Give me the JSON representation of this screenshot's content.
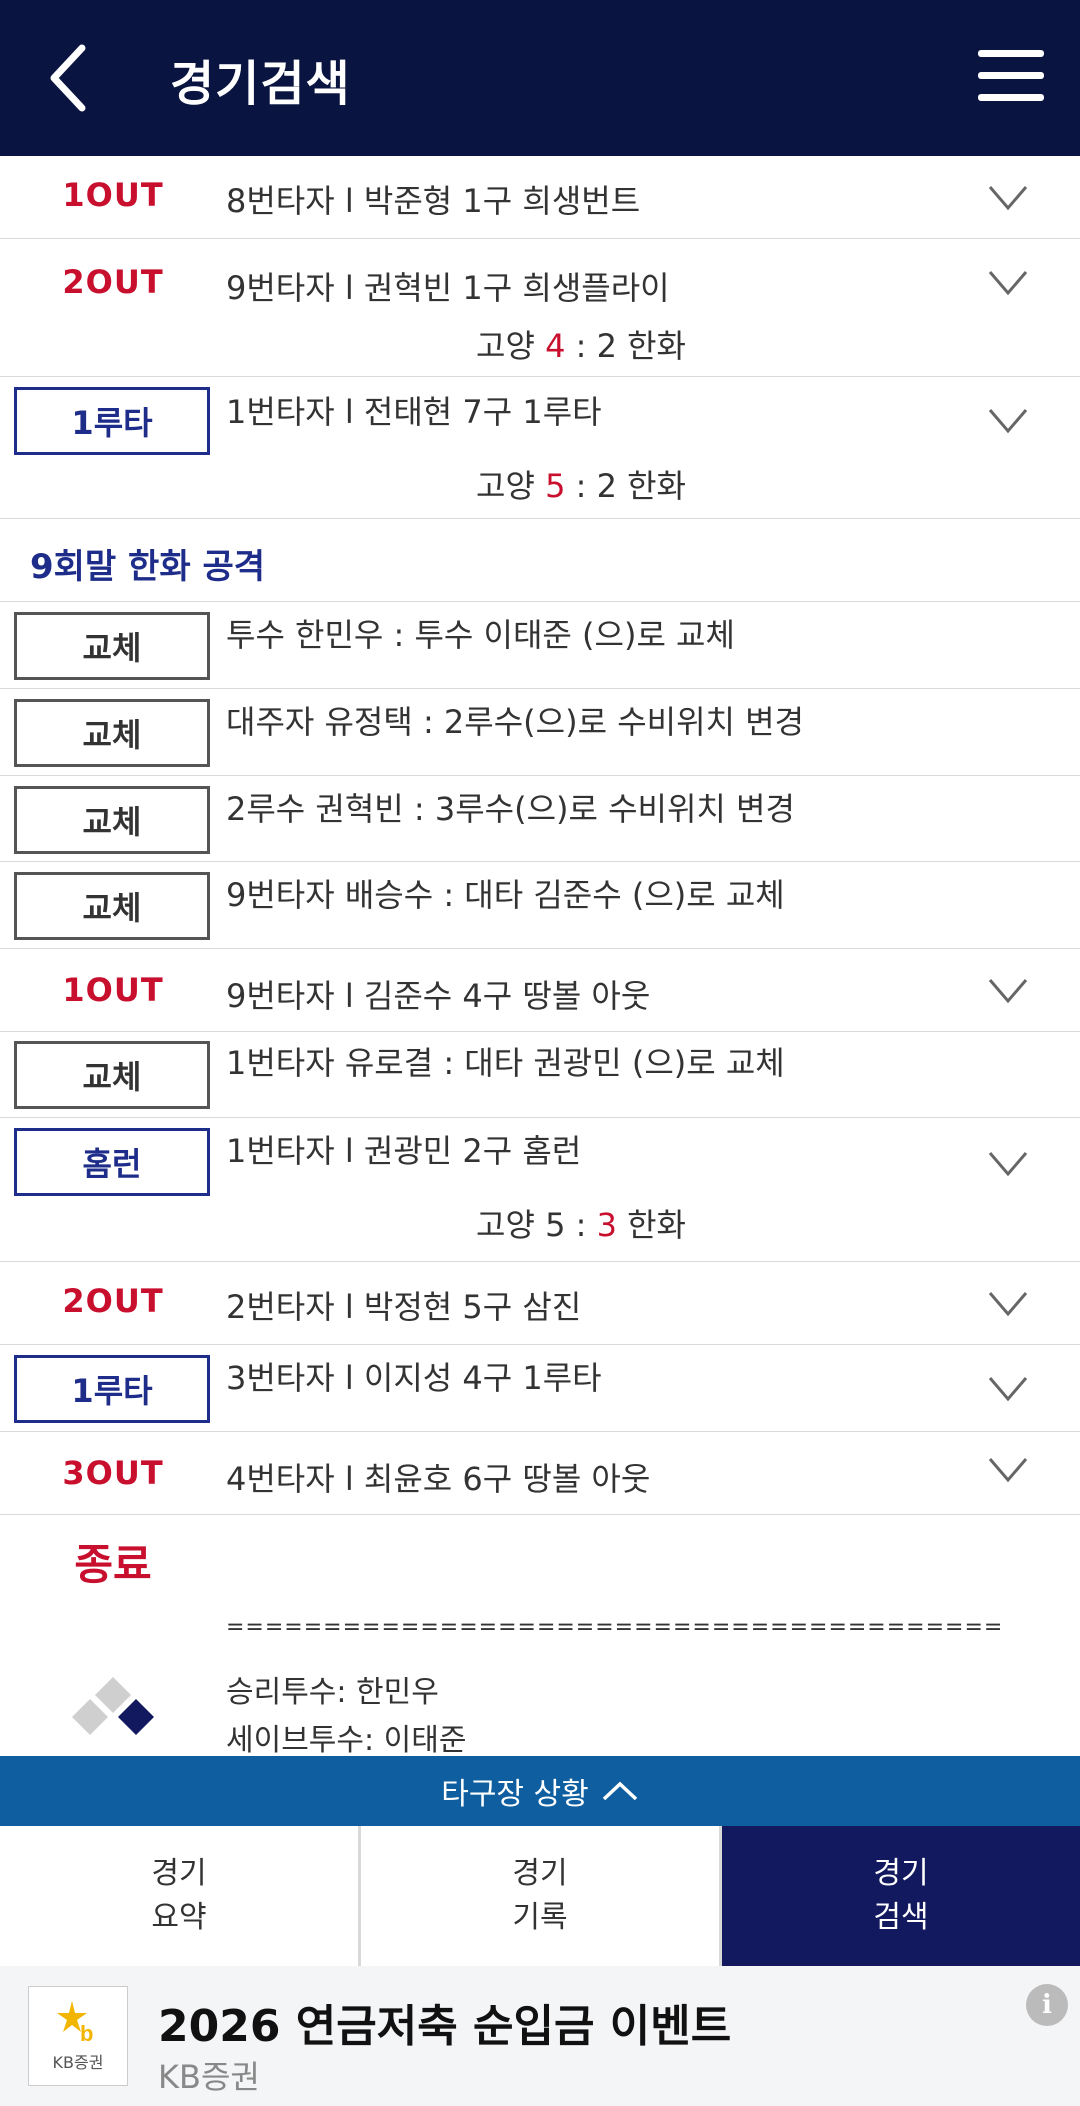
{
  "header": {
    "title": "경기검색"
  },
  "feed": {
    "r1": {
      "badge": "1OUT",
      "desc": "8번타자 l 박준형 1구 희생번트"
    },
    "r2": {
      "badge": "2OUT",
      "desc": "9번타자 l 권혁빈 1구 희생플라이",
      "score_left": "고양 ",
      "score_hl": "4",
      "score_right": " : 2 한화"
    },
    "r3": {
      "badge": "1루타",
      "desc": "1번타자 l 전태현 7구 1루타",
      "score_left": "고양 ",
      "score_hl": "5",
      "score_right": " : 2 한화"
    },
    "inning": "9회말 한화 공격",
    "r4": {
      "badge": "교체",
      "desc": "투수 한민우 : 투수 이태준 (으)로 교체"
    },
    "r5": {
      "badge": "교체",
      "desc": "대주자 유정택 : 2루수(으)로 수비위치 변경"
    },
    "r6": {
      "badge": "교체",
      "desc": "2루수 권혁빈 : 3루수(으)로 수비위치 변경"
    },
    "r7": {
      "badge": "교체",
      "desc": "9번타자 배승수 : 대타 김준수 (으)로 교체"
    },
    "r8": {
      "badge": "1OUT",
      "desc": "9번타자 l 김준수 4구 땅볼 아웃"
    },
    "r9": {
      "badge": "교체",
      "desc": "1번타자 유로결 : 대타 권광민 (으)로 교체"
    },
    "r10": {
      "badge": "홈런",
      "desc": "1번타자 l 권광민 2구 홈런",
      "score_left": "고양 5 : ",
      "score_hl": "3",
      "score_right": " 한화"
    },
    "r11": {
      "badge": "2OUT",
      "desc": "2번타자 l 박정현 5구 삼진"
    },
    "r12": {
      "badge": "1루타",
      "desc": "3번타자 l 이지성 4구 1루타"
    },
    "r13": {
      "badge": "3OUT",
      "desc": "4번타자 l 최윤호 6구 땅볼 아웃"
    },
    "end": {
      "label": "종료",
      "divider": "========================================",
      "win": "승리투수: 한민우",
      "save": "세이브투수: 이태준"
    }
  },
  "field_bar": {
    "label": "타구장 상황"
  },
  "tabs": [
    {
      "line1": "경기",
      "line2": "요약"
    },
    {
      "line1": "경기",
      "line2": "기록"
    },
    {
      "line1": "경기",
      "line2": "검색"
    }
  ],
  "ad": {
    "logo_text": "KB증권",
    "title": "2026 연금저축 순입금 이벤트",
    "sponsor": "KB증권",
    "info": "i"
  },
  "colors": {
    "header_bg": "#0a1440",
    "out_red": "#c8102e",
    "badge_blue": "#1f2d8a",
    "field_bar_blue": "#0f5fa0",
    "active_tab": "#13195e"
  },
  "icons": [
    "back-chevron-icon",
    "menu-icon",
    "expand-chevron-icon",
    "caret-up-icon",
    "kb-logo-icon",
    "info-icon",
    "diamond-field-icon"
  ]
}
